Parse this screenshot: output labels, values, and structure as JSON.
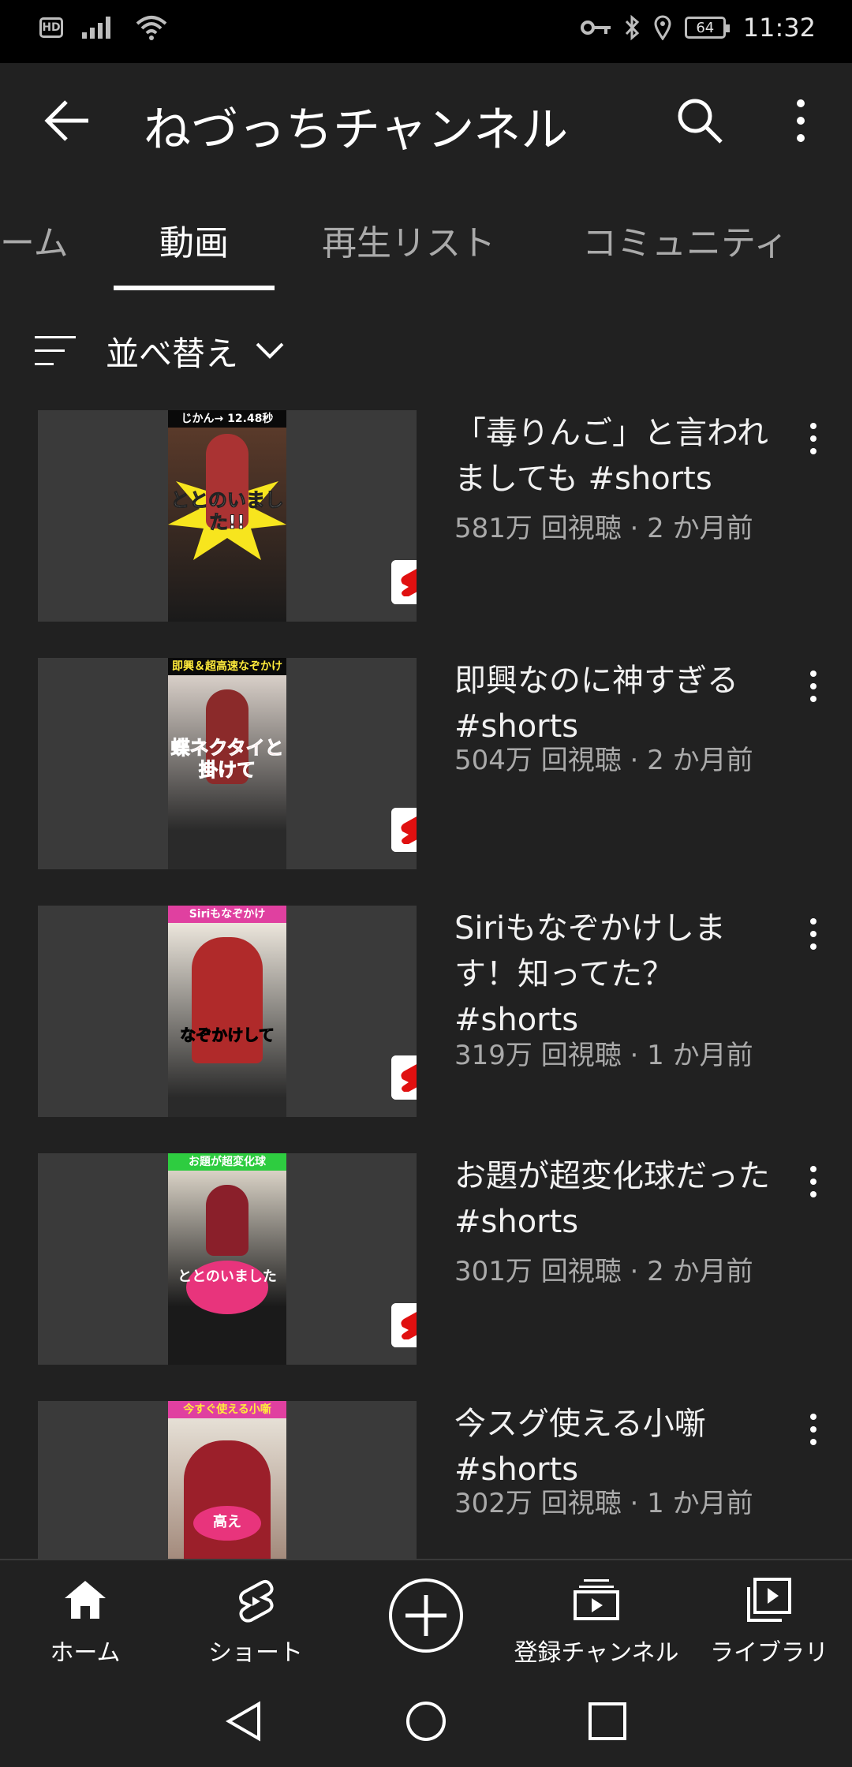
{
  "status_bar": {
    "hd": "HD",
    "battery": "64",
    "time": "11:32",
    "icons": [
      "signal-icon",
      "wifi-icon",
      "key-icon",
      "bluetooth-icon",
      "location-icon",
      "battery-icon"
    ]
  },
  "appbar": {
    "title": "ねづっちチャンネル",
    "icons": [
      "back-arrow-icon",
      "search-icon",
      "more-vert-icon"
    ]
  },
  "tabs": [
    {
      "label": "ーム",
      "active": false
    },
    {
      "label": "動画",
      "active": true
    },
    {
      "label": "再生リスト",
      "active": false
    },
    {
      "label": "コミュニティ",
      "active": false
    }
  ],
  "sort": {
    "label": "並べ替え",
    "icons": [
      "sort-icon",
      "chevron-down-icon"
    ]
  },
  "videos": [
    {
      "title": "「毒りんご」と言われましても #shorts",
      "meta": "581万 回視聴 · 2 か月前",
      "thumb_header": "じかん→ 12.48秒",
      "thumb_overlay": "ととのいました!!"
    },
    {
      "title": "即興なのに神すぎる #shorts",
      "meta": "504万 回視聴 · 2 か月前",
      "thumb_header": "即興＆超高速なぞかけ",
      "thumb_overlay": "蝶ネクタイと掛けて"
    },
    {
      "title": "Siriもなぞかけします！知ってた？ #shorts",
      "meta": "319万 回視聴 · 1 か月前",
      "thumb_header": "Siriもなぞかけ",
      "thumb_overlay": "なぞかけして"
    },
    {
      "title": "お題が超変化球だった #shorts",
      "meta": "301万 回視聴 · 2 か月前",
      "thumb_header": "お題が超変化球",
      "thumb_overlay": "ととのいました"
    },
    {
      "title": "今スグ使える小噺 #shorts",
      "meta": "302万 回視聴 · 1 か月前",
      "thumb_header": "今すぐ使える小噺",
      "thumb_overlay": "高え"
    }
  ],
  "bottom_nav": [
    {
      "label": "ホーム",
      "icon": "home-icon"
    },
    {
      "label": "ショート",
      "icon": "shorts-icon"
    },
    {
      "label": "",
      "icon": "create-plus-icon"
    },
    {
      "label": "登録チャンネル",
      "icon": "subscriptions-icon"
    },
    {
      "label": "ライブラリ",
      "icon": "library-icon"
    }
  ],
  "system_nav": [
    "back-triangle-icon",
    "home-circle-icon",
    "recents-square-icon"
  ]
}
